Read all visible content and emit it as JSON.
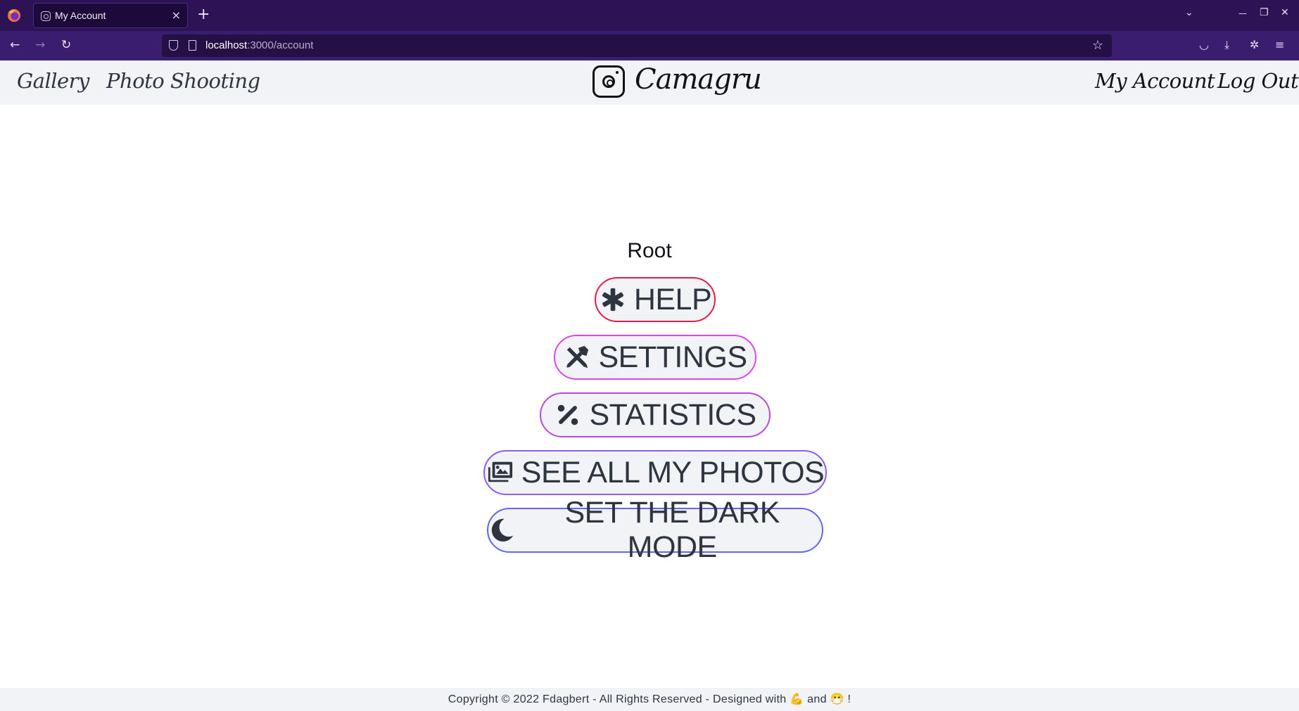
{
  "browser": {
    "tab_title": "My Account",
    "tab_close": "×",
    "new_tab": "+",
    "url_host": "localhost",
    "url_path": ":3000/account",
    "back": "←",
    "forward": "→",
    "reload": "↻",
    "bookmark": "☆",
    "tabs_menu": "⌄",
    "minimize": "—",
    "restore": "❐",
    "close": "✕",
    "pocket": "◡",
    "download": "⤓",
    "extensions": "✲",
    "menu": "≡"
  },
  "header": {
    "nav_left": [
      "Gallery",
      "Photo Shooting"
    ],
    "brand": "Camagru",
    "nav_right": [
      "My Account",
      "Log Out"
    ]
  },
  "main": {
    "username": "Root",
    "buttons": [
      {
        "label": "HELP",
        "icon": "asterisk-icon",
        "border_color": "#e11d48"
      },
      {
        "label": "SETTINGS",
        "icon": "tools-icon",
        "border_color": "#d946ef"
      },
      {
        "label": "STATISTICS",
        "icon": "percent-icon",
        "border_color": "#b44be1"
      },
      {
        "label": "SEE ALL MY PHOTOS",
        "icon": "images-icon",
        "border_color": "#8b5cf6"
      },
      {
        "label": "SET THE DARK MODE",
        "icon": "moon-icon",
        "border_color": "#6366f1"
      }
    ]
  },
  "footer": {
    "text": "Copyright © 2022 Fdagbert - All Rights Reserved - Designed with 💪 and 😷 !"
  }
}
